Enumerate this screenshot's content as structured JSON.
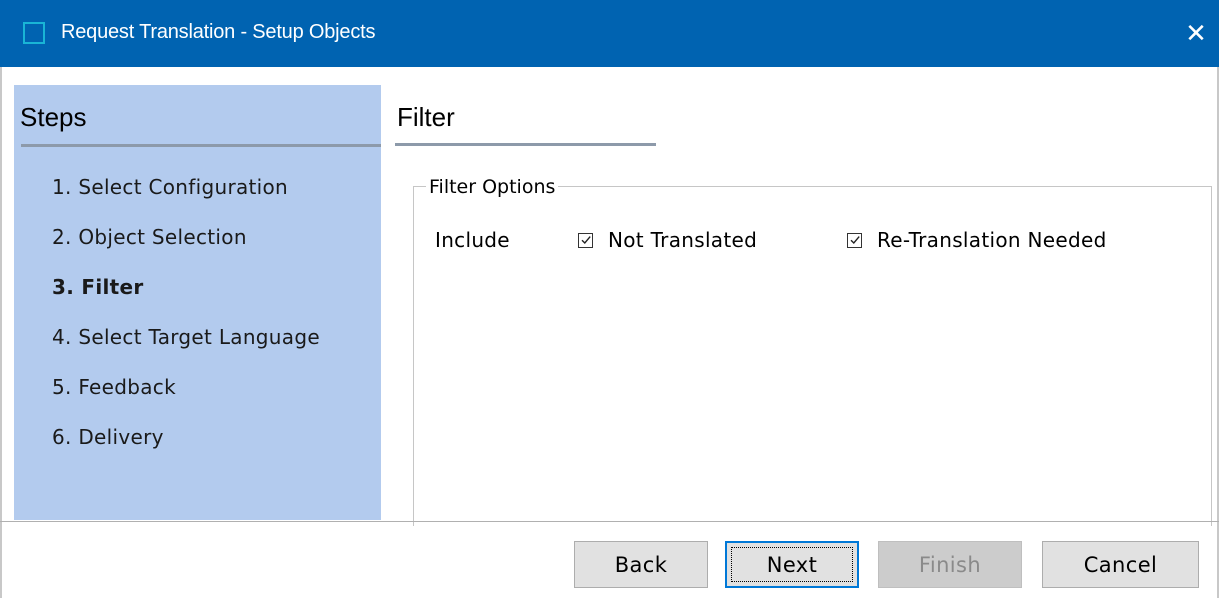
{
  "window": {
    "title": "Request Translation - Setup Objects",
    "close_glyph": "✕",
    "accent_color": "#0063b1"
  },
  "steps": {
    "heading": "Steps",
    "items": [
      {
        "label": "1. Select Configuration",
        "active": false
      },
      {
        "label": "2. Object Selection",
        "active": false
      },
      {
        "label": "3. Filter",
        "active": true
      },
      {
        "label": "4. Select Target Language",
        "active": false
      },
      {
        "label": "5. Feedback",
        "active": false
      },
      {
        "label": "6. Delivery",
        "active": false
      }
    ]
  },
  "page": {
    "title": "Filter",
    "group_title": "Filter Options",
    "include_label": "Include",
    "options": [
      {
        "label": "Not Translated",
        "checked": true
      },
      {
        "label": "Re-Translation Needed",
        "checked": true
      }
    ]
  },
  "buttons": {
    "back": "Back",
    "next": "Next",
    "finish": "Finish",
    "cancel": "Cancel"
  }
}
